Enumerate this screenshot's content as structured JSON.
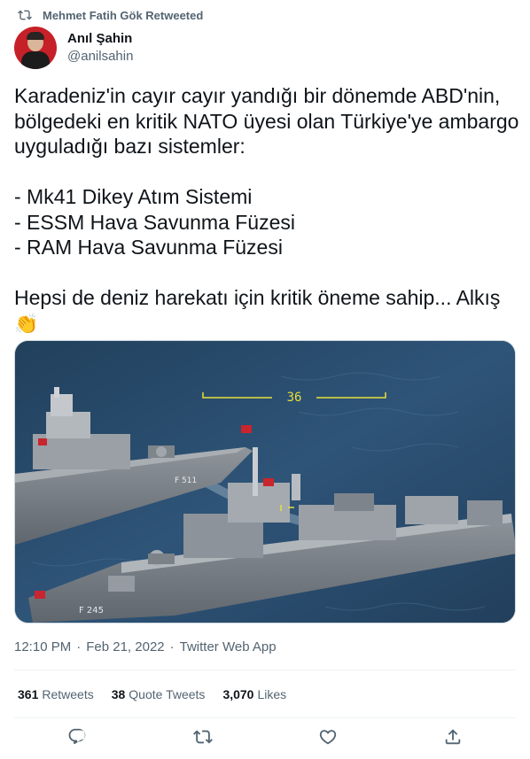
{
  "retweet_bar": {
    "text": "Mehmet Fatih Gök Retweeted",
    "icon": "retweet-icon"
  },
  "author": {
    "name": "Anıl Şahin",
    "handle": "@anilsahin"
  },
  "tweet": {
    "lines": [
      "Karadeniz'in cayır cayır yandığı bir dönemde ABD'nin, bölgedeki en kritik NATO üyesi olan Türkiye'ye ambargo uyguladığı bazı sistemler:",
      "",
      "- Mk41 Dikey Atım Sistemi",
      "- ESSM Hava Savunma Füzesi",
      "- RAM Hava Savunma Füzesi",
      "",
      "Hepsi de deniz harekatı için kritik öneme sahip... Alkış"
    ],
    "emoji": "👏"
  },
  "media": {
    "overlay_number": "36",
    "hull_numbers": [
      "F 511",
      "F 245"
    ]
  },
  "meta": {
    "time": "12:10 PM",
    "date": "Feb 21, 2022",
    "source": "Twitter Web App",
    "separator": "·"
  },
  "stats": {
    "retweets_count": "361",
    "retweets_label": "Retweets",
    "quotes_count": "38",
    "quotes_label": "Quote Tweets",
    "likes_count": "3,070",
    "likes_label": "Likes"
  },
  "actions": [
    "reply-icon",
    "retweet-icon",
    "like-icon",
    "share-icon"
  ],
  "colors": {
    "secondary_text": "#536471",
    "primary_text": "#0f1419",
    "divider": "#eff3f4",
    "sea": "#2b4a66"
  }
}
